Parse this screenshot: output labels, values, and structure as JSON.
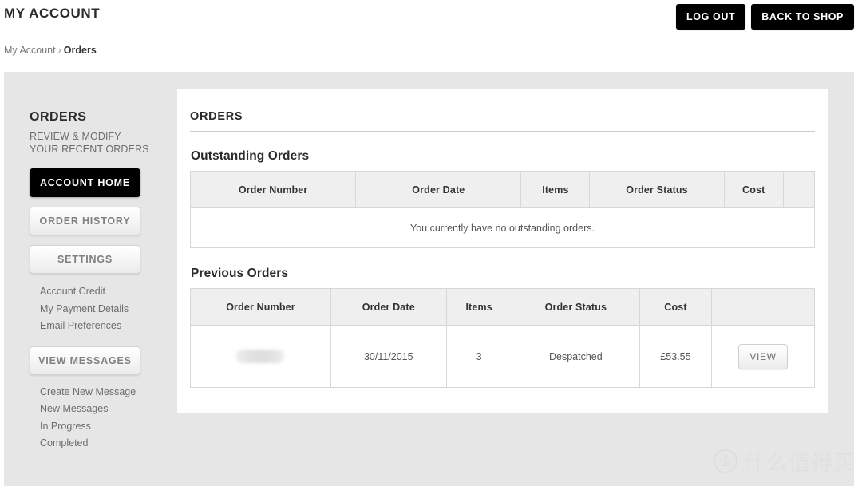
{
  "header": {
    "title": "MY ACCOUNT",
    "logout_label": "LOG OUT",
    "back_to_shop_label": "BACK TO SHOP"
  },
  "breadcrumb": {
    "root": "My Account",
    "separator": "›",
    "current": "Orders"
  },
  "sidebar": {
    "title": "ORDERS",
    "subtitle": "REVIEW & MODIFY YOUR RECENT ORDERS",
    "buttons": [
      {
        "label": "ACCOUNT HOME",
        "style": "dark"
      },
      {
        "label": "ORDER HISTORY",
        "style": "light"
      },
      {
        "label": "SETTINGS",
        "style": "light"
      }
    ],
    "account_links": [
      "Account Credit",
      "My Payment Details",
      "Email Preferences"
    ],
    "messages_button": "VIEW MESSAGES",
    "message_links": [
      "Create New Message",
      "New Messages",
      "In Progress",
      "Completed"
    ]
  },
  "main": {
    "title": "ORDERS",
    "outstanding": {
      "heading": "Outstanding Orders",
      "columns": [
        "Order Number",
        "Order Date",
        "Items",
        "Order Status",
        "Cost",
        ""
      ],
      "empty_message": "You currently have no outstanding orders.",
      "rows": []
    },
    "previous": {
      "heading": "Previous Orders",
      "columns": [
        "Order Number",
        "Order Date",
        "Items",
        "Order Status",
        "Cost",
        ""
      ],
      "rows": [
        {
          "order_number": "",
          "order_number_redacted": true,
          "order_date": "30/11/2015",
          "items": "3",
          "order_status": "Despatched",
          "cost": "£53.55",
          "action_label": "VIEW"
        }
      ]
    }
  },
  "watermark": {
    "badge": "值",
    "text": "什么值得买"
  },
  "colors": {
    "panel_bg": "#e6e6e6",
    "card_bg": "#ffffff",
    "accent_dark": "#000000",
    "table_header_bg": "#efefef",
    "border": "#d7d7d7"
  }
}
